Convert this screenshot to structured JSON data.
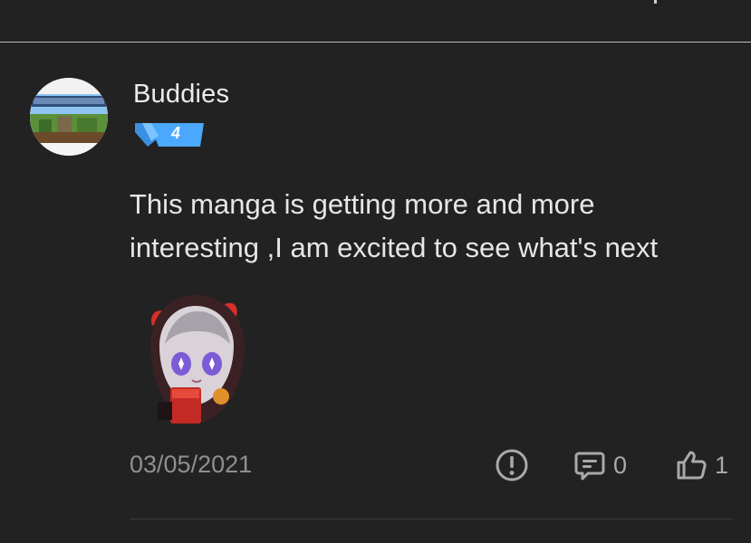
{
  "comment": {
    "username": "Buddies",
    "level": "4",
    "avatar_icon": "minecraft-avatar-icon",
    "body": "This manga is getting more and more interesting ,I am excited to see what's next",
    "sticker": "devil-girl-sticker",
    "date": "03/05/2021",
    "reply_count": "0",
    "like_count": "1"
  },
  "colors": {
    "background": "#222223",
    "badge_blue": "#4aa8ff",
    "text": "#e6e6e6",
    "muted": "#8f8f8f"
  }
}
